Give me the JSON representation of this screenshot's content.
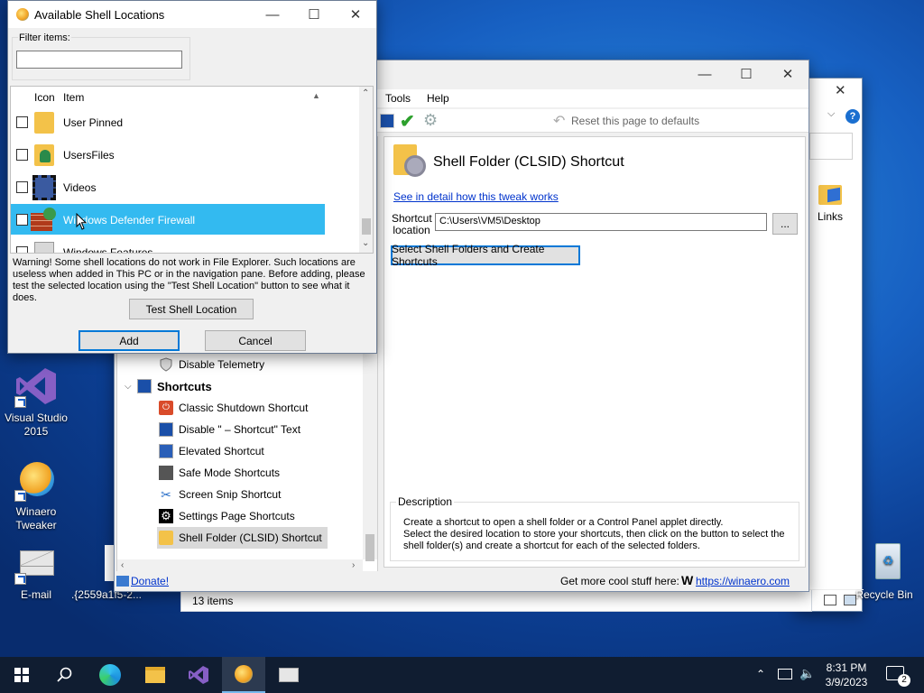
{
  "desktop": {
    "icons": [
      {
        "label": "Visual Studio 2015"
      },
      {
        "label": "Winaero Tweaker"
      },
      {
        "label": "E-mail"
      },
      {
        "label": ".{2559a1f5-2..."
      },
      {
        "label": "Links"
      },
      {
        "label": "Recycle Bin"
      }
    ]
  },
  "explorer": {
    "status": "13 items"
  },
  "tweaker": {
    "menu": [
      "Tools",
      "Help"
    ],
    "reset": "Reset this page to defaults",
    "tree": {
      "items": [
        {
          "label": "Disable Telemetry"
        },
        {
          "label": "Classic Shutdown Shortcut"
        },
        {
          "label": "Disable \" – Shortcut\" Text"
        },
        {
          "label": "Elevated Shortcut"
        },
        {
          "label": "Safe Mode Shortcuts"
        },
        {
          "label": "Screen Snip Shortcut"
        },
        {
          "label": "Settings Page Shortcuts"
        },
        {
          "label": "Shell Folder (CLSID) Shortcut"
        }
      ],
      "group": "Shortcuts"
    },
    "page_title": "Shell Folder (CLSID) Shortcut",
    "detail_link": "See in detail how this tweak works",
    "shortcut_label_1": "Shortcut",
    "shortcut_label_2": "location",
    "shortcut_value": "C:\\Users\\VM5\\Desktop",
    "browse": "...",
    "select_button": "Select Shell Folders and Create Shortcuts",
    "description_title": "Description",
    "description_1": "Create a shortcut to open a shell folder or a Control Panel applet directly.",
    "description_2": "Select the desired location to store your shortcuts, then click on the button to select the shell folder(s) and create a shortcut for each of the selected folders.",
    "donate": "Donate!",
    "more": "Get more cool stuff here:",
    "site": "https://winaero.com"
  },
  "dialog": {
    "title": "Available Shell Locations",
    "filter_label": "Filter items:",
    "filter_value": "",
    "col_icon": "Icon",
    "col_item": "Item",
    "rows": [
      {
        "label": "User Pinned",
        "selected": false
      },
      {
        "label": "UsersFiles",
        "selected": false
      },
      {
        "label": "Videos",
        "selected": false
      },
      {
        "label": "Windows Defender Firewall",
        "selected": true
      },
      {
        "label": "Windows Features",
        "selected": false
      }
    ],
    "warning": "Warning! Some shell locations do not work in File Explorer. Such locations are useless when added in This PC or in the navigation pane. Before adding, please test the selected location using the \"Test Shell Location\" button to see what it does.",
    "test_button": "Test Shell Location",
    "add_button": "Add",
    "cancel_button": "Cancel"
  },
  "taskbar": {
    "time": "8:31 PM",
    "date": "3/9/2023",
    "notif_count": "2"
  }
}
